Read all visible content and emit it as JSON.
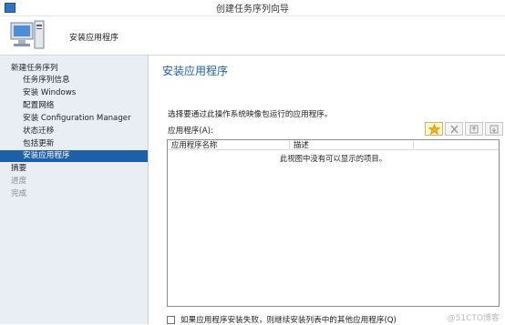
{
  "window": {
    "title": "创建任务序列向导"
  },
  "header": {
    "title": "安装应用程序"
  },
  "sidebar": {
    "items": [
      {
        "label": "新建任务序列",
        "level": "top",
        "state": "normal"
      },
      {
        "label": "任务序列信息",
        "level": "sub",
        "state": "normal"
      },
      {
        "label": "安装 Windows",
        "level": "sub",
        "state": "normal"
      },
      {
        "label": "配置网络",
        "level": "sub",
        "state": "normal"
      },
      {
        "label": "安装 Configuration Manager",
        "level": "sub",
        "state": "normal"
      },
      {
        "label": "状态迁移",
        "level": "sub",
        "state": "normal"
      },
      {
        "label": "包括更新",
        "level": "sub",
        "state": "normal"
      },
      {
        "label": "安装应用程序",
        "level": "sub",
        "state": "selected"
      },
      {
        "label": "摘要",
        "level": "top",
        "state": "normal"
      },
      {
        "label": "进度",
        "level": "top",
        "state": "disabled"
      },
      {
        "label": "完成",
        "level": "top",
        "state": "disabled"
      }
    ]
  },
  "main": {
    "section_title": "安装应用程序",
    "description": "选择要通过此操作系统映像包运行的应用程序。",
    "apps_label": "应用程序(A):",
    "toolbar": [
      {
        "icon": "add-star-icon"
      },
      {
        "icon": "delete-x-icon"
      },
      {
        "icon": "move-up-icon"
      },
      {
        "icon": "move-down-icon"
      }
    ],
    "list": {
      "columns": [
        "应用程序名称",
        "描述"
      ],
      "empty_message": "此视图中没有可以显示的项目。"
    },
    "continue_checkbox": {
      "label": "如果应用程序安装失败，则继续安装列表中的其他应用程序(Q)",
      "checked": false
    }
  },
  "watermark": "@51CTO博客"
}
